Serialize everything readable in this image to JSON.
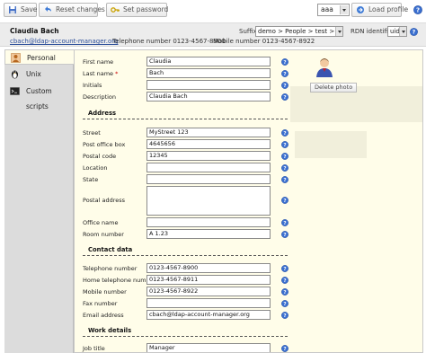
{
  "toolbar": {
    "save_label": "Save",
    "reset_label": "Reset changes",
    "set_password_label": "Set password",
    "profile_select_value": "aaa",
    "load_profile_label": "Load profile"
  },
  "user": {
    "name": "Claudia Bach",
    "email": "cbach@ldap-account-manager.org",
    "telephone": "Telephone number 0123-4567-8900",
    "mobile": "Mobile number 0123-4567-8922",
    "suffix_label": "Suffix",
    "suffix_value": "demo > People > test > de",
    "rdn_label": "RDN identifier",
    "rdn_value": "uid"
  },
  "tabs": [
    {
      "label": "Personal",
      "icon": "personal-icon",
      "active": true
    },
    {
      "label": "Unix",
      "icon": "tux-icon",
      "active": false
    },
    {
      "label": "Custom scripts",
      "icon": "terminal-icon",
      "active": false
    }
  ],
  "photo": {
    "delete_label": "Delete photo"
  },
  "fields": {
    "first_name": {
      "label": "First name",
      "value": "Claudia"
    },
    "last_name": {
      "label": "Last name",
      "value": "Bach",
      "required_mark": "*"
    },
    "initials": {
      "label": "Initials",
      "value": ""
    },
    "description": {
      "label": "Description",
      "value": "Claudia Bach"
    },
    "street": {
      "label": "Street",
      "value": "MyStreet 123"
    },
    "po_box": {
      "label": "Post office box",
      "value": "4645656"
    },
    "postal_code": {
      "label": "Postal code",
      "value": "12345"
    },
    "location": {
      "label": "Location",
      "value": ""
    },
    "state": {
      "label": "State",
      "value": ""
    },
    "postal_address": {
      "label": "Postal address",
      "value": ""
    },
    "office_name": {
      "label": "Office name",
      "value": ""
    },
    "room_number": {
      "label": "Room number",
      "value": "A 1.23"
    },
    "telephone": {
      "label": "Telephone number",
      "value": "0123-4567-8900"
    },
    "home_telephone": {
      "label": "Home telephone number",
      "value": "0123-4567-8911"
    },
    "mobile": {
      "label": "Mobile number",
      "value": "0123-4567-8922"
    },
    "fax": {
      "label": "Fax number",
      "value": ""
    },
    "email": {
      "label": "Email address",
      "value": "cbach@ldap-account-manager.org"
    },
    "job_title": {
      "label": "Job title",
      "value": "Manager"
    }
  },
  "sections": {
    "address": "Address",
    "contact": "Contact data",
    "work": "Work details"
  },
  "colors": {
    "content_bg": "#fffde9",
    "tab_bg": "#dcdcdc",
    "help_blue": "#3a6fd0",
    "link_blue": "#2c4e9a"
  }
}
